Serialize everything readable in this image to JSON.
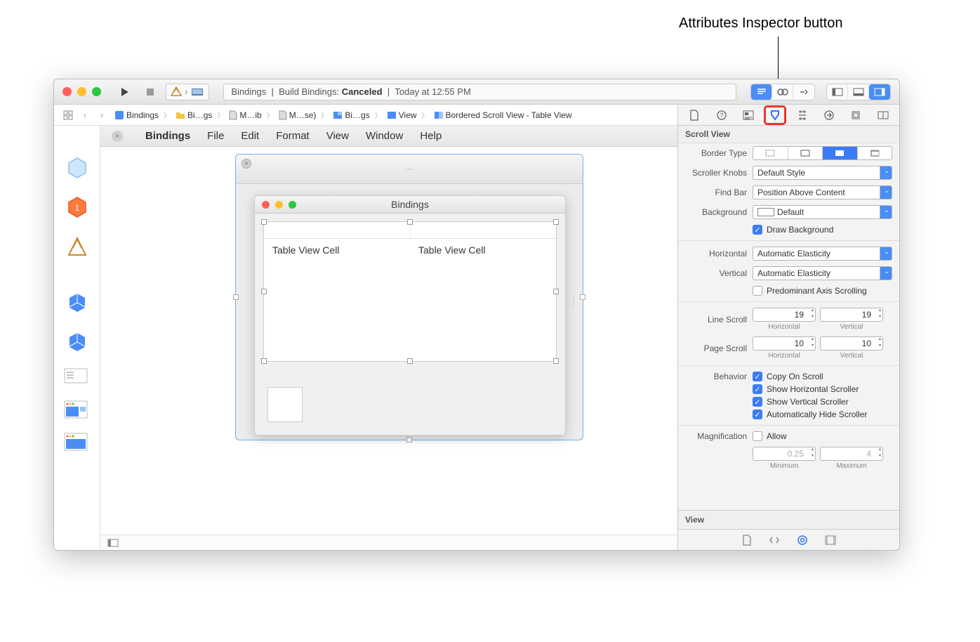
{
  "annotation": {
    "label": "Attributes Inspector button"
  },
  "titlebar": {
    "status_prefix": "Bindings",
    "status_sep": "|",
    "status_build": "Build Bindings:",
    "status_result": "Canceled",
    "status_sep2": "|",
    "status_time": "Today at 12:55 PM"
  },
  "breadcrumb": {
    "items": [
      "Bindings",
      "Bi…gs",
      "M…ib",
      "M…se)",
      "Bi…gs",
      "View",
      "Bordered Scroll View - Table View"
    ]
  },
  "app_menubar": {
    "app": "Bindings",
    "items": [
      "File",
      "Edit",
      "Format",
      "View",
      "Window",
      "Help"
    ]
  },
  "ib_window": {
    "title": "Bindings",
    "inner_title": "Bindings",
    "cell1": "Table View Cell",
    "cell2": "Table View Cell"
  },
  "inspector": {
    "section1": "Scroll View",
    "border_type_label": "Border Type",
    "scroller_knobs_label": "Scroller Knobs",
    "scroller_knobs_value": "Default Style",
    "find_bar_label": "Find Bar",
    "find_bar_value": "Position Above Content",
    "background_label": "Background",
    "background_value": "Default",
    "draw_bg": "Draw Background",
    "horizontal_label": "Horizontal",
    "horizontal_value": "Automatic Elasticity",
    "vertical_label": "Vertical",
    "vertical_value": "Automatic Elasticity",
    "predominant": "Predominant Axis Scrolling",
    "line_scroll_label": "Line Scroll",
    "line_scroll_h": "19",
    "line_scroll_v": "19",
    "sub_h": "Horizontal",
    "sub_v": "Vertical",
    "page_scroll_label": "Page Scroll",
    "page_scroll_h": "10",
    "page_scroll_v": "10",
    "behavior_label": "Behavior",
    "copy_on_scroll": "Copy On Scroll",
    "show_h": "Show Horizontal Scroller",
    "show_v": "Show Vertical Scroller",
    "auto_hide": "Automatically Hide Scroller",
    "magnification_label": "Magnification",
    "allow": "Allow",
    "min_val": "0.25",
    "max_val": "4",
    "min_label": "Minimum",
    "max_label": "Maximum",
    "section2": "View"
  }
}
